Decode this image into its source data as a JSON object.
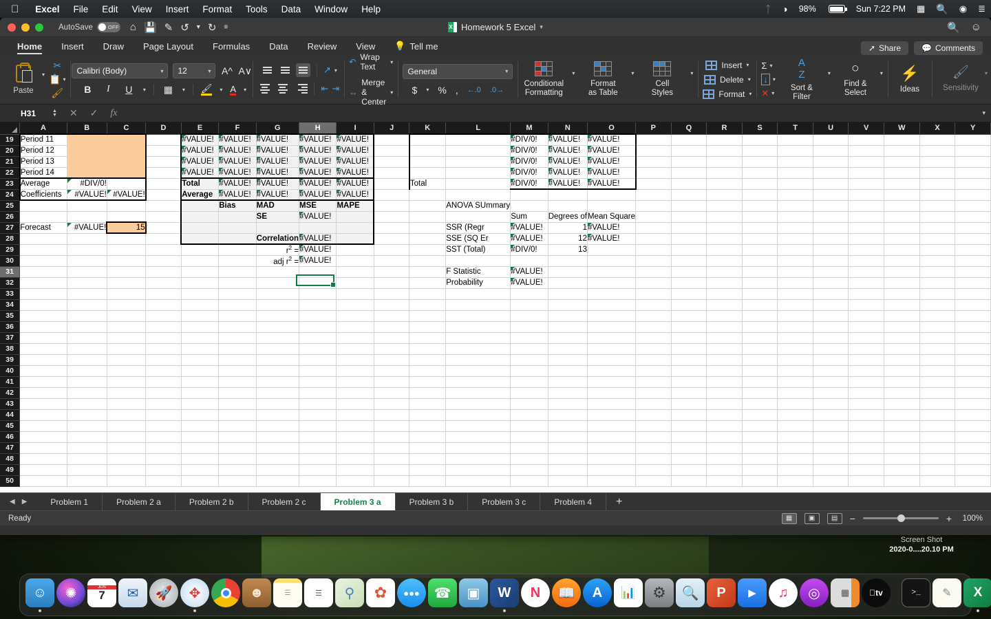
{
  "menubar": {
    "apple_icon": "apple-icon",
    "items": [
      "Excel",
      "File",
      "Edit",
      "View",
      "Insert",
      "Format",
      "Tools",
      "Data",
      "Window",
      "Help"
    ],
    "right": {
      "bluetooth_icon": "bluetooth-icon",
      "wifi_icon": "wifi-icon",
      "battery_percent": "98%",
      "battery_icon": "battery-icon",
      "clock": "Sun 7:22 PM",
      "input_menu_icon": "keyboard-input-icon",
      "search_icon": "spotlight-search-icon",
      "siri_icon": "siri-icon",
      "control_center_icon": "control-center-icon"
    }
  },
  "window": {
    "title": "Homework 5 Excel",
    "title_icon": "excel-document-icon",
    "title_chevron": "chevron-down-icon",
    "traffic": {
      "close": "close-window-button",
      "minimize": "minimize-window-button",
      "zoom": "zoom-window-button"
    },
    "autosave": {
      "label": "AutoSave",
      "state": "OFF"
    },
    "quick_access": [
      "home-icon",
      "save-icon",
      "save-as-icon",
      "undo-icon",
      "undo-chevron-icon",
      "redo-icon",
      "customize-toolbar-icon"
    ],
    "right_icons": [
      "search-icon",
      "account-icon"
    ]
  },
  "ribbon": {
    "tabs": [
      {
        "label": "Home",
        "active": true
      },
      {
        "label": "Insert",
        "active": false
      },
      {
        "label": "Draw",
        "active": false
      },
      {
        "label": "Page Layout",
        "active": false
      },
      {
        "label": "Formulas",
        "active": false
      },
      {
        "label": "Data",
        "active": false
      },
      {
        "label": "Review",
        "active": false
      },
      {
        "label": "View",
        "active": false
      },
      {
        "label": "Tell me",
        "active": false,
        "icon": "lightbulb-icon"
      }
    ],
    "share_label": "Share",
    "comments_label": "Comments",
    "clipboard": {
      "paste_label": "Paste",
      "paste_icon": "paste-icon",
      "cut_icon": "cut-scissors-icon",
      "copy_icon": "copy-icon",
      "format_painter_icon": "format-painter-icon"
    },
    "font": {
      "name": "Calibri (Body)",
      "size": "12",
      "grow_icon": "increase-font-size-icon",
      "shrink_icon": "decrease-font-size-icon",
      "bold": "B",
      "italic": "I",
      "underline": "U",
      "borders_icon": "borders-icon",
      "fill_color_icon": "fill-color-icon",
      "font_color_icon": "font-color-icon"
    },
    "alignment": {
      "top_align_icon": "align-top-icon",
      "middle_align_icon": "align-middle-icon",
      "bottom_align_icon": "align-bottom-icon",
      "orientation_icon": "text-orientation-icon",
      "left_align_icon": "align-left-icon",
      "center_align_icon": "align-center-icon",
      "right_align_icon": "align-right-icon",
      "decrease_indent_icon": "decrease-indent-icon",
      "increase_indent_icon": "increase-indent-icon",
      "wrap_text_label": "Wrap Text",
      "wrap_text_icon": "wrap-text-icon",
      "merge_center_label": "Merge & Center",
      "merge_center_icon": "merge-center-icon"
    },
    "number": {
      "format": "General",
      "currency_icon": "currency-icon",
      "percent_icon": "percent-icon",
      "comma_icon": "comma-style-icon",
      "increase_decimal_icon": "increase-decimal-icon",
      "decrease_decimal_icon": "decrease-decimal-icon"
    },
    "styles": {
      "conditional_formatting": "Conditional\nFormatting",
      "conditional_formatting_l1": "Conditional",
      "conditional_formatting_l2": "Formatting",
      "format_as_table_l1": "Format",
      "format_as_table_l2": "as Table",
      "cell_styles_l1": "Cell",
      "cell_styles_l2": "Styles"
    },
    "cells": {
      "insert_label": "Insert",
      "delete_label": "Delete",
      "format_label": "Format",
      "insert_icon": "insert-cells-icon",
      "delete_icon": "delete-cells-icon",
      "format_icon": "format-cells-icon"
    },
    "editing": {
      "autosum_icon": "autosum-icon",
      "fill_icon": "fill-down-icon",
      "clear_icon": "clear-icon",
      "sort_filter_l1": "Sort &",
      "sort_filter_l2": "Filter",
      "sort_filter_icon": "sort-filter-icon",
      "find_select_l1": "Find &",
      "find_select_l2": "Select",
      "find_select_icon": "find-select-icon"
    },
    "ideas": {
      "label": "Ideas",
      "icon": "ideas-lightning-icon"
    },
    "sensitivity": {
      "label": "Sensitivity",
      "icon": "sensitivity-icon"
    }
  },
  "formula_bar": {
    "name_box": "H31",
    "cancel_icon": "cancel-icon",
    "enter_icon": "confirm-icon",
    "function_icon": "insert-function-icon",
    "value": "",
    "expand_icon": "expand-formula-bar-icon"
  },
  "grid": {
    "columns": [
      "A",
      "B",
      "C",
      "D",
      "E",
      "F",
      "G",
      "H",
      "I",
      "J",
      "K",
      "L",
      "M",
      "N",
      "O",
      "P",
      "Q",
      "R",
      "S",
      "T",
      "U",
      "V",
      "W",
      "X",
      "Y"
    ],
    "selected_column": "H",
    "selected_row": "31",
    "active_cell": "H31",
    "rows": [
      "19",
      "20",
      "21",
      "22",
      "23",
      "24",
      "25",
      "26",
      "27",
      "28",
      "29",
      "30",
      "31",
      "32",
      "33",
      "34",
      "35",
      "36",
      "37",
      "38",
      "39",
      "40",
      "41",
      "42",
      "43",
      "44",
      "45",
      "46",
      "47",
      "48",
      "49",
      "50"
    ],
    "cells": {
      "A19": "Period 11",
      "A20": "Period 12",
      "A21": "Period 13",
      "A22": "Period 14",
      "A23": "Average",
      "A24": "Coefficients",
      "A27": "Forecast",
      "B23": "#DIV/0!",
      "B24": "#VALUE!",
      "B27": "#VALUE!",
      "C24": "#VALUE!",
      "C27": "15",
      "E19": "#VALUE!",
      "F19": "#VALUE!",
      "G19": "#VALUE!",
      "H19": "#VALUE!",
      "I19": "#VALUE!",
      "E20": "#VALUE!",
      "F20": "#VALUE!",
      "G20": "#VALUE!",
      "H20": "#VALUE!",
      "I20": "#VALUE!",
      "E21": "#VALUE!",
      "F21": "#VALUE!",
      "G21": "#VALUE!",
      "H21": "#VALUE!",
      "I21": "#VALUE!",
      "E22": "#VALUE!",
      "F22": "#VALUE!",
      "G22": "#VALUE!",
      "H22": "#VALUE!",
      "I22": "#VALUE!",
      "E23": "Total",
      "F23": "#VALUE!",
      "G23": "#VALUE!",
      "H23": "#VALUE!",
      "I23": "#VALUE!",
      "E24": "Average",
      "F24": "#VALUE!",
      "G24": "#VALUE!",
      "H24": "#VALUE!",
      "I24": "#VALUE!",
      "F25": "Bias",
      "G25": "MAD",
      "H25": "MSE",
      "I25": "MAPE",
      "G26": "SE",
      "H26": "#VALUE!",
      "G28": "Correlation",
      "H28": "#VALUE!",
      "G29": "r² =",
      "H29": "#VALUE!",
      "G30": "adj r² =",
      "H30": "#VALUE!",
      "K23": "Total",
      "M19": "#DIV/0!",
      "N19": "#VALUE!",
      "O19": "#VALUE!",
      "M20": "#DIV/0!",
      "N20": "#VALUE!",
      "O20": "#VALUE!",
      "M21": "#DIV/0!",
      "N21": "#VALUE!",
      "O21": "#VALUE!",
      "M22": "#DIV/0!",
      "N22": "#VALUE!",
      "O22": "#VALUE!",
      "M23": "#DIV/0!",
      "N23": "#VALUE!",
      "O23": "#VALUE!",
      "L25": "ANOVA SUmmary",
      "M26": "Sum",
      "N26": "Degrees of",
      "O26": "Mean Square",
      "L27": "SSR (Regr",
      "M27": "#VALUE!",
      "N27": "1",
      "O27": "#VALUE!",
      "L28": "SSE (SQ Er",
      "M28": "#VALUE!",
      "N28": "12",
      "O28": "#VALUE!",
      "L29": "SST (Total)",
      "M29": "#DIV/0!",
      "N29": "13",
      "L31": "F Statistic",
      "M31": "#VALUE!",
      "L32": "Probability",
      "M32": "#VALUE!"
    }
  },
  "sheet_tabs": {
    "prev_icon": "previous-sheet-icon",
    "next_icon": "next-sheet-icon",
    "add_icon": "add-sheet-icon",
    "tabs": [
      {
        "label": "Problem 1",
        "active": false
      },
      {
        "label": "Problem 2 a",
        "active": false
      },
      {
        "label": "Problem 2 b",
        "active": false
      },
      {
        "label": "Problem 2 c",
        "active": false
      },
      {
        "label": "Problem 3 a",
        "active": true
      },
      {
        "label": "Problem 3 b",
        "active": false
      },
      {
        "label": "Problem 3 c",
        "active": false
      },
      {
        "label": "Problem 4",
        "active": false
      }
    ]
  },
  "status_bar": {
    "state": "Ready",
    "normal_view_icon": "normal-view-icon",
    "page_layout_icon": "page-layout-view-icon",
    "page_break_icon": "page-break-view-icon",
    "zoom_out_icon": "zoom-out-icon",
    "zoom_in_icon": "zoom-in-icon",
    "zoom_level": "100%"
  },
  "desktop": {
    "screenshot_thumb": {
      "line1": "Screen Shot",
      "line2": "2020-0....20.10 PM"
    }
  },
  "dock": {
    "items": [
      {
        "name": "finder",
        "glyph": "☺",
        "bg": "#4aa8e8",
        "running": true
      },
      {
        "name": "siri",
        "glyph": "✺",
        "bg": "#2a2a40",
        "running": false
      },
      {
        "name": "calendar",
        "glyph": "7",
        "bg": "#ffffff",
        "running": false
      },
      {
        "name": "mail",
        "glyph": "✉",
        "bg": "#e8eef5",
        "running": false
      },
      {
        "name": "launchpad",
        "glyph": "▲",
        "bg": "#c9cdd2",
        "running": false
      },
      {
        "name": "safari",
        "glyph": "⦿",
        "bg": "#d8e8f4",
        "running": true
      },
      {
        "name": "chrome",
        "glyph": "●",
        "bg": "#ffffff",
        "running": false
      },
      {
        "name": "contacts",
        "glyph": "☻",
        "bg": "#b07c46",
        "running": false
      },
      {
        "name": "notes",
        "glyph": "≡",
        "bg": "#fdf6d8",
        "running": false
      },
      {
        "name": "reminders",
        "glyph": "☰",
        "bg": "#ffffff",
        "running": false
      },
      {
        "name": "maps",
        "glyph": "⌖",
        "bg": "#e8f0e2",
        "running": false
      },
      {
        "name": "photos",
        "glyph": "✿",
        "bg": "#ffffff",
        "running": false
      },
      {
        "name": "messages",
        "glyph": "●●●",
        "bg": "#2aa8f2",
        "running": false
      },
      {
        "name": "facetime",
        "glyph": "☎",
        "bg": "#30d158",
        "running": false
      },
      {
        "name": "keynote",
        "glyph": "▣",
        "bg": "#5aa9d8",
        "running": false
      },
      {
        "name": "word",
        "glyph": "W",
        "bg": "#2b579a",
        "running": true
      },
      {
        "name": "news",
        "glyph": "N",
        "bg": "#ffffff",
        "running": false
      },
      {
        "name": "books",
        "glyph": "◖",
        "bg": "#ff8c24",
        "running": false
      },
      {
        "name": "app-store",
        "glyph": "A",
        "bg": "#1b8cf5",
        "running": false
      },
      {
        "name": "numbers",
        "glyph": "‖",
        "bg": "#ffffff",
        "running": false
      },
      {
        "name": "system-preferences",
        "glyph": "⚙",
        "bg": "#8a8a8a",
        "running": false
      },
      {
        "name": "preview",
        "glyph": "⌕",
        "bg": "#d8e8f0",
        "running": false
      },
      {
        "name": "powerpoint",
        "glyph": "P",
        "bg": "#d04423",
        "running": false
      },
      {
        "name": "zoom",
        "glyph": "▶",
        "bg": "#2d8cff",
        "running": false
      },
      {
        "name": "music",
        "glyph": "♫",
        "bg": "#ffffff",
        "running": false
      },
      {
        "name": "podcasts",
        "glyph": "◎",
        "bg": "#9b30d9",
        "running": false
      },
      {
        "name": "calculator",
        "glyph": "▦",
        "bg": "#d8d8d8",
        "running": false
      },
      {
        "name": "apple-tv",
        "glyph": "tv",
        "bg": "#0d0d0d",
        "running": false
      },
      {
        "name": "terminal",
        "glyph": ">_",
        "bg": "#1a1a1a",
        "running": false
      },
      {
        "name": "textedit",
        "glyph": "✎",
        "bg": "#fbfbf4",
        "running": false
      },
      {
        "name": "excel",
        "glyph": "X",
        "bg": "#1d8a4c",
        "running": true
      },
      {
        "name": "help-viewer",
        "glyph": "?",
        "bg": "transparent",
        "running": false
      },
      {
        "name": "document-stack",
        "glyph": "▤",
        "bg": "#e8e8e8",
        "running": false
      },
      {
        "name": "trash",
        "glyph": "Ὕ1",
        "bg": "#b9bcc0",
        "running": false
      }
    ]
  }
}
